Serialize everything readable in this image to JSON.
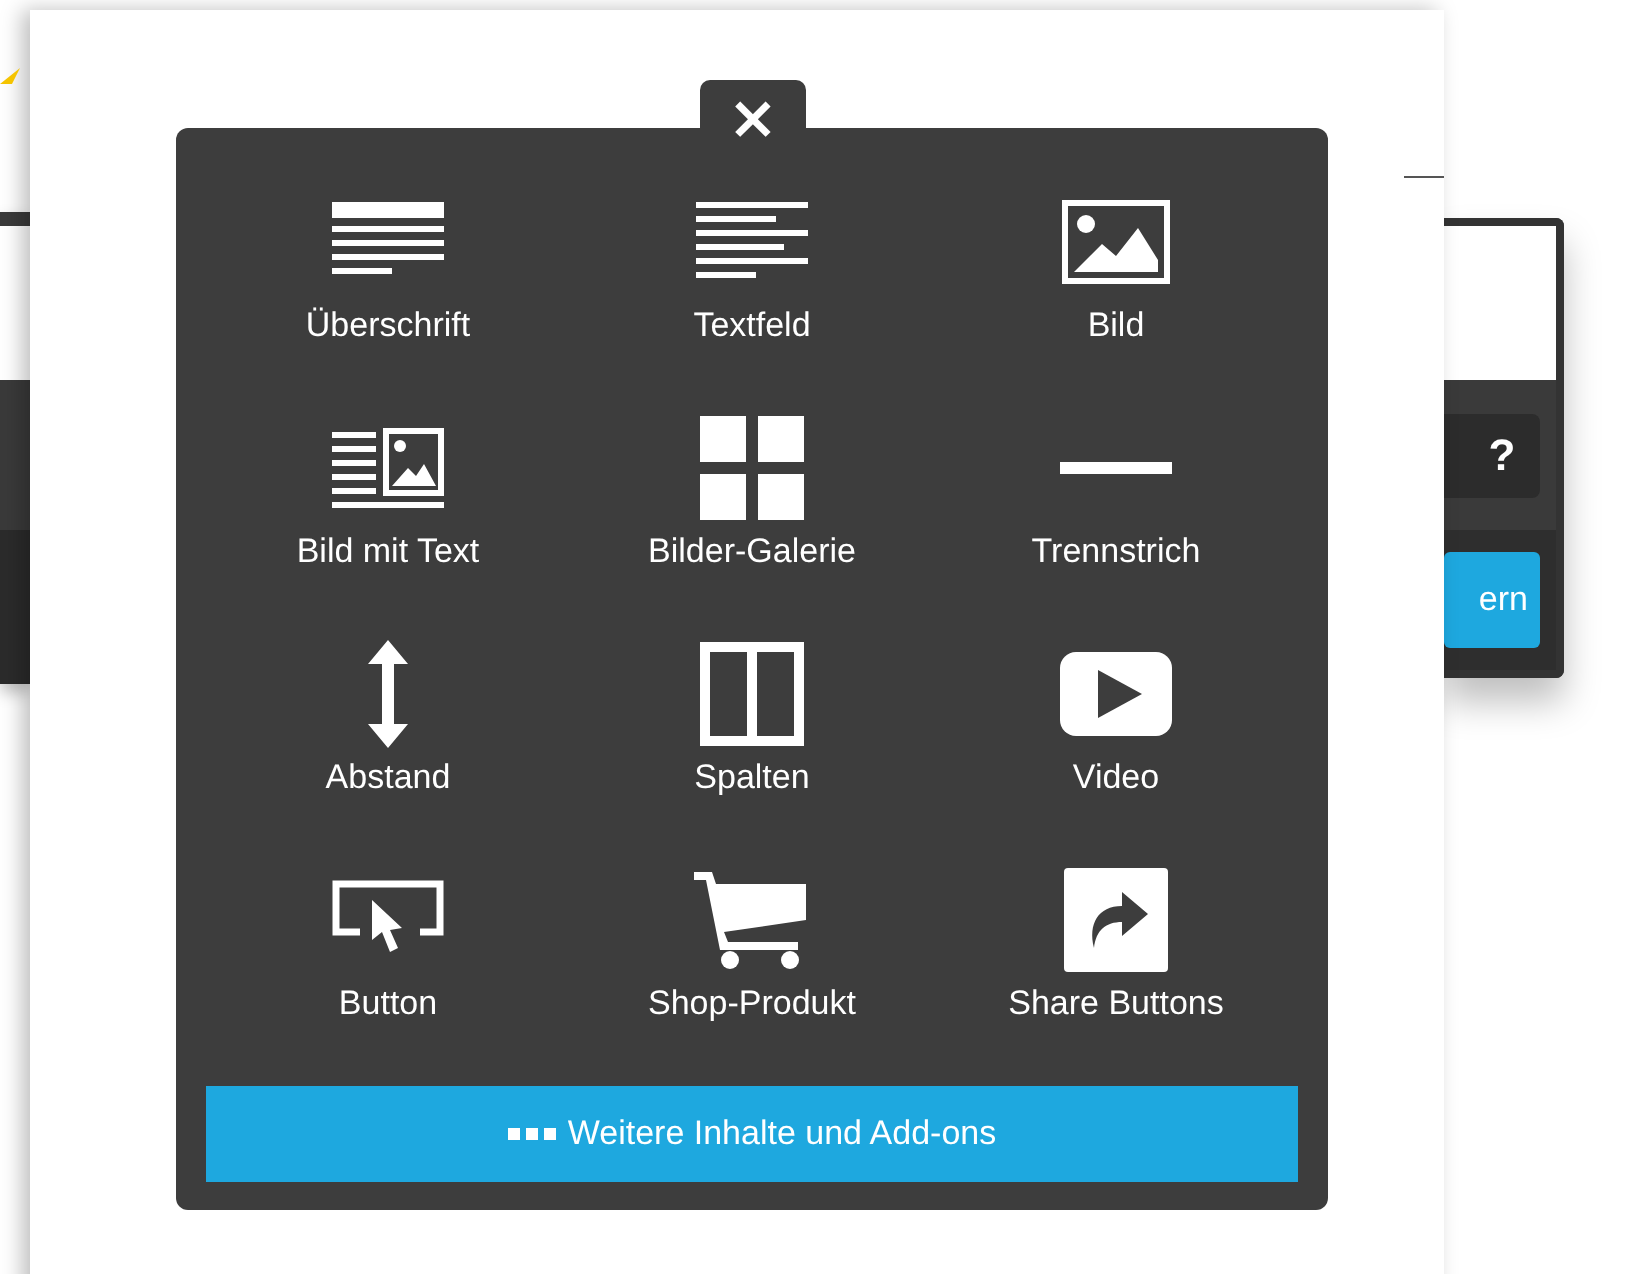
{
  "background_dialog": {
    "help_button": "?",
    "save_button": "ern"
  },
  "add_content_menu": {
    "close": "×",
    "items": [
      {
        "kind": "heading",
        "label": "Überschrift"
      },
      {
        "kind": "text",
        "label": "Textfeld"
      },
      {
        "kind": "image",
        "label": "Bild"
      },
      {
        "kind": "image-text",
        "label": "Bild mit Text"
      },
      {
        "kind": "gallery",
        "label": "Bilder-Galerie"
      },
      {
        "kind": "divider",
        "label": "Trennstrich"
      },
      {
        "kind": "spacer",
        "label": "Abstand"
      },
      {
        "kind": "columns",
        "label": "Spalten"
      },
      {
        "kind": "video",
        "label": "Video"
      },
      {
        "kind": "button",
        "label": "Button"
      },
      {
        "kind": "product",
        "label": "Shop-Produkt"
      },
      {
        "kind": "share",
        "label": "Share Buttons"
      }
    ],
    "more_button": "Weitere Inhalte und Add-ons"
  }
}
